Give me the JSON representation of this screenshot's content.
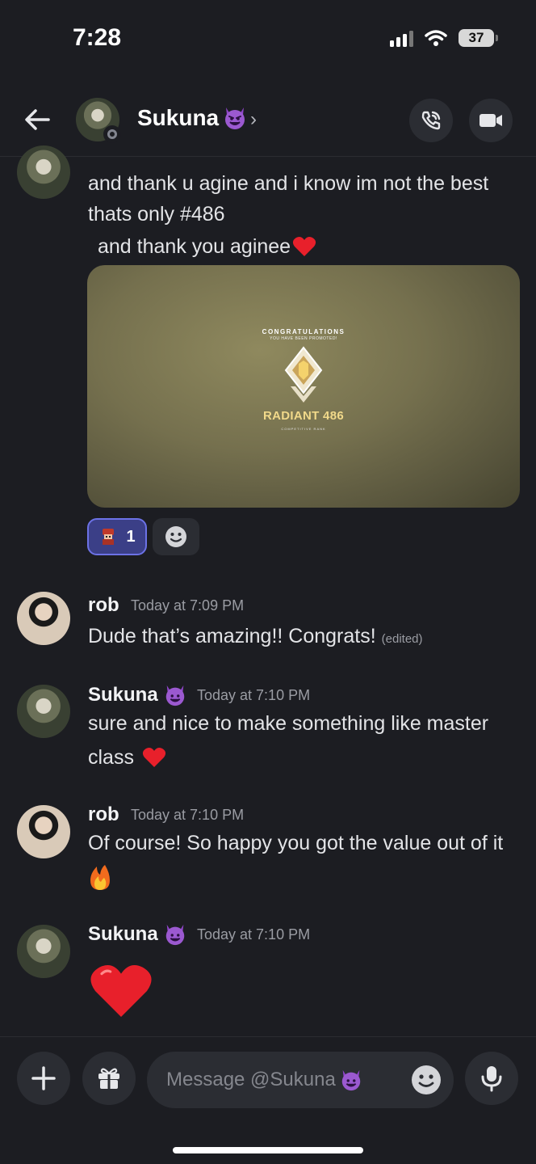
{
  "status_bar": {
    "time": "7:28",
    "battery": "37"
  },
  "header": {
    "name": "Sukuna",
    "chevron": "›"
  },
  "messages": {
    "top": {
      "line1": "and thank u agine and  i know im not the best",
      "line2": "thats only #486",
      "line3": "and thank you aginee"
    },
    "m1": {
      "author": "rob",
      "time": "Today at 7:09 PM",
      "text": "Dude that’s amazing!! Congrats!",
      "edited": "(edited)"
    },
    "m2": {
      "author": "Sukuna",
      "time": "Today at 7:10 PM",
      "line1": "sure and nice to make something like master",
      "line2": "class"
    },
    "m3": {
      "author": "rob",
      "time": "Today at 7:10 PM",
      "line1": "Of course! So happy you got the value out of it"
    },
    "m4": {
      "author": "Sukuna",
      "time": "Today at 7:10 PM"
    }
  },
  "embed": {
    "congrats": "CONGRATULATIONS",
    "promoted": "YOU HAVE BEEN PROMOTED!",
    "rank": "RADIANT 486",
    "subtitle": "COMPETITIVE RANK"
  },
  "reactions": {
    "count": "1"
  },
  "composer": {
    "placeholder": "Message @Sukuna"
  },
  "icons": {
    "back": "arrow-left-icon",
    "call": "phone-call-icon",
    "video": "video-camera-icon",
    "add": "plus-icon",
    "gift": "gift-icon",
    "emoji": "smiley-icon",
    "mic": "microphone-icon"
  },
  "colors": {
    "background": "#1c1d22",
    "surface": "#2b2d33",
    "reaction_accent": "#6c72e6",
    "rank_gold": "#f1d98a"
  }
}
